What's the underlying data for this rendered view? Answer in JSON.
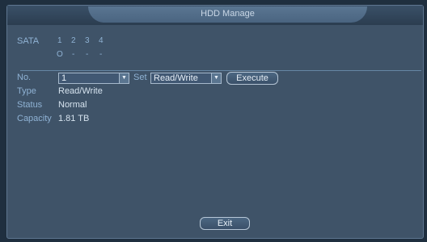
{
  "window": {
    "title": "HDD Manage"
  },
  "sata": {
    "label": "SATA",
    "ports": [
      "1",
      "2",
      "3",
      "4"
    ],
    "status": [
      "O",
      "-",
      "-",
      "-"
    ]
  },
  "controls": {
    "no_label": "No.",
    "no_value": "1",
    "set_label": "Set",
    "set_value": "Read/Write",
    "execute_label": "Execute"
  },
  "info": {
    "type_label": "Type",
    "type_value": "Read/Write",
    "status_label": "Status",
    "status_value": "Normal",
    "capacity_label": "Capacity",
    "capacity_value": "1.81 TB"
  },
  "footer": {
    "exit_label": "Exit"
  }
}
